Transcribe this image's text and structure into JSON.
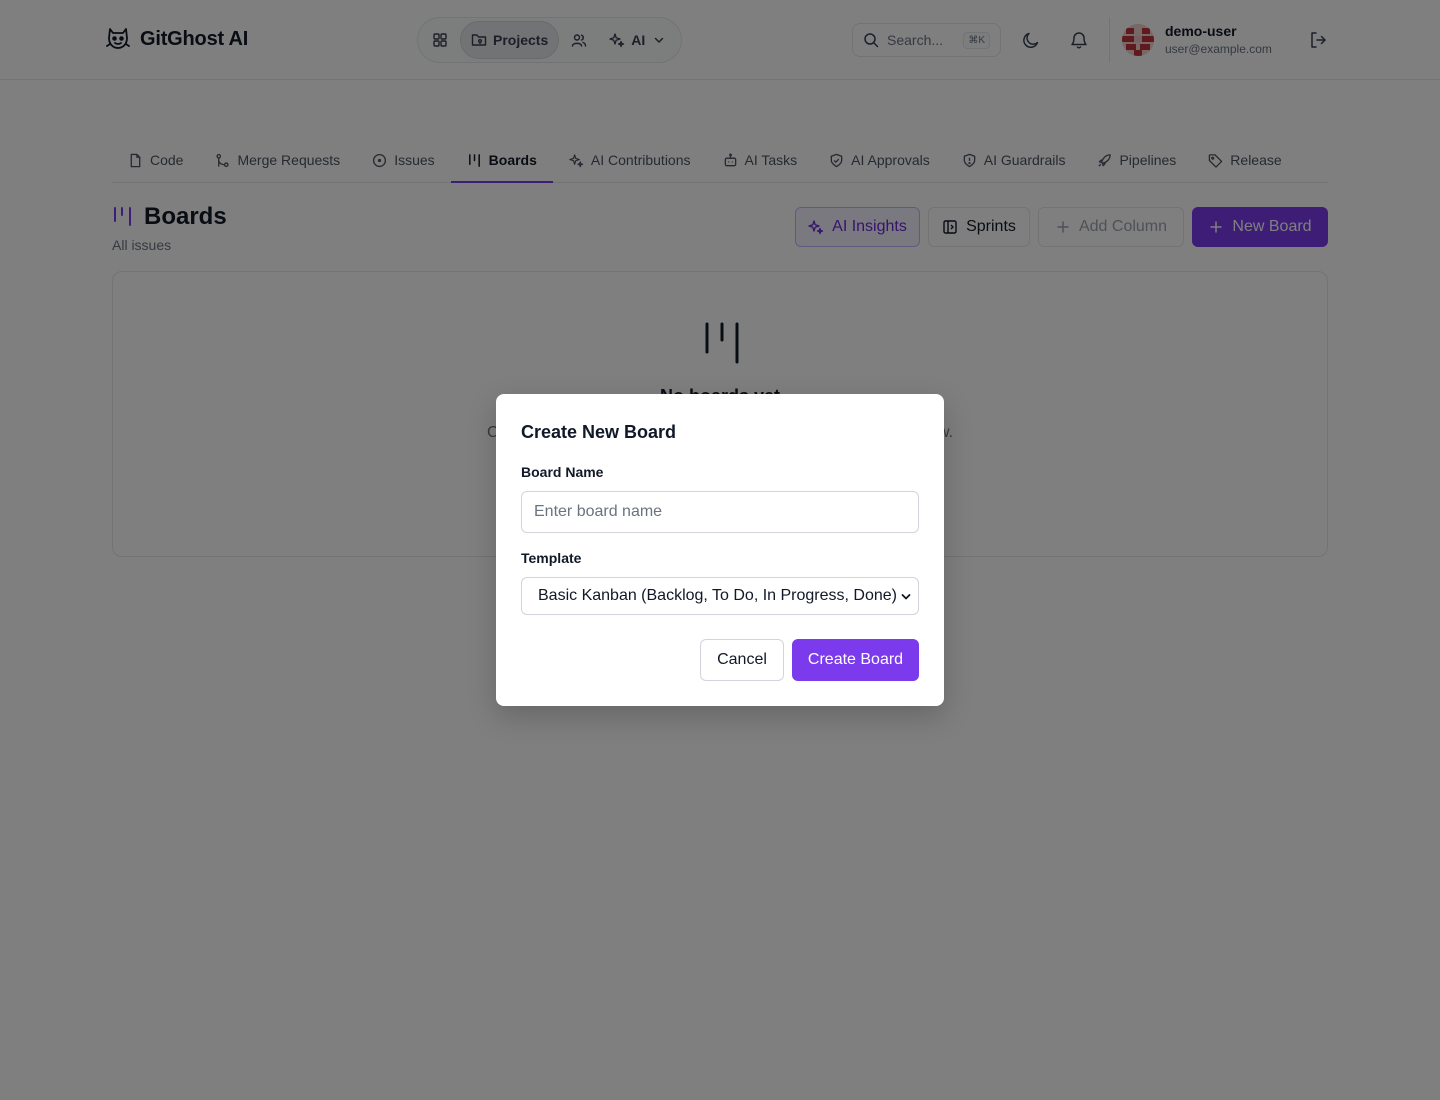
{
  "app": {
    "name": "GitGhost AI"
  },
  "nav": {
    "projects_label": "Projects",
    "ai_label": "AI"
  },
  "search": {
    "placeholder": "Search...",
    "shortcut": "⌘K"
  },
  "user": {
    "name": "demo-user",
    "email": "user@example.com"
  },
  "tabs": [
    {
      "label": "Code",
      "icon": "file-icon"
    },
    {
      "label": "Merge Requests",
      "icon": "git-merge-icon"
    },
    {
      "label": "Issues",
      "icon": "circle-dot-icon"
    },
    {
      "label": "Boards",
      "icon": "kanban-icon",
      "active": true
    },
    {
      "label": "AI Contributions",
      "icon": "sparkles-icon"
    },
    {
      "label": "AI Tasks",
      "icon": "bot-icon"
    },
    {
      "label": "AI Approvals",
      "icon": "shield-check-icon"
    },
    {
      "label": "AI Guardrails",
      "icon": "shield-alert-icon"
    },
    {
      "label": "Pipelines",
      "icon": "rocket-icon"
    },
    {
      "label": "Release",
      "icon": "tag-icon"
    }
  ],
  "page": {
    "title": "Boards",
    "subtitle": "All issues",
    "actions": {
      "insights": "AI Insights",
      "sprints": "Sprints",
      "add_column": "Add Column",
      "new_board": "New Board"
    }
  },
  "empty": {
    "title": "No boards yet",
    "description": "Create your first board to organize issues into a Kanban workflow."
  },
  "modal": {
    "title": "Create New Board",
    "name_label": "Board Name",
    "name_placeholder": "Enter board name",
    "name_value": "",
    "template_label": "Template",
    "template_selected": "Basic Kanban (Backlog, To Do, In Progress, Done)",
    "cancel": "Cancel",
    "create": "Create Board"
  },
  "colors": {
    "accent": "#7c3aed",
    "overlay": "rgba(0,0,0,0.5)"
  }
}
